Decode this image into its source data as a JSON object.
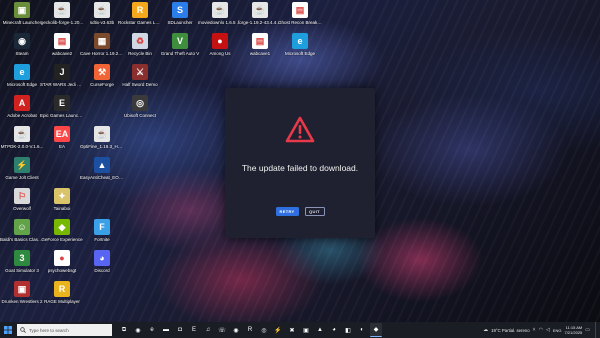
{
  "desktop": {
    "icons": [
      {
        "label": "Minecraft Launcher",
        "icon": "minecraft-icon",
        "color": "#6b8e3a",
        "glyph": "▣"
      },
      {
        "label": "geckolib-forge-1.20...",
        "icon": "java-file-icon",
        "color": "#e6e6e6",
        "glyph": "☕"
      },
      {
        "label": "sdtix-v3.63b",
        "icon": "java-file-icon",
        "color": "#e6e6e6",
        "glyph": "☕"
      },
      {
        "label": "Rockstar Games Launcher",
        "icon": "rockstar-icon",
        "color": "#f5a81c",
        "glyph": "R"
      },
      {
        "label": "SDLauncher",
        "icon": "sdlauncher-icon",
        "color": "#2b7de9",
        "glyph": "S"
      },
      {
        "label": "moviedownlo 1.6.5 (1)",
        "icon": "java-file-icon",
        "color": "#e6e6e6",
        "glyph": "☕"
      },
      {
        "label": "forge-1.19.2-43.4.4... (1)",
        "icon": "java-file-icon",
        "color": "#e6e6e6",
        "glyph": "☕"
      },
      {
        "label": "Ghost Recon Breakpoint Demo",
        "icon": "document-icon",
        "color": "#ffffff",
        "glyph": "▤"
      },
      {
        "label": "Steam",
        "icon": "steam-icon",
        "color": "#1b2838",
        "glyph": "◉"
      },
      {
        "label": "wabcave2",
        "icon": "document-icon",
        "color": "#ffffff",
        "glyph": "▤"
      },
      {
        "label": "Cave Horror 1.19.2-v1.2.7",
        "icon": "cave-horror-icon",
        "color": "#7a4a2a",
        "glyph": "▦"
      },
      {
        "label": "Recycle Bin",
        "icon": "recycle-bin-icon",
        "color": "#cfd8e3",
        "glyph": "♻"
      },
      {
        "label": "Grand Theft Auto V",
        "icon": "gta-icon",
        "color": "#3e8e3e",
        "glyph": "V"
      },
      {
        "label": "Among Us",
        "icon": "among-us-icon",
        "color": "#c51111",
        "glyph": "●"
      },
      {
        "label": "wabcave1",
        "icon": "document-icon",
        "color": "#ffffff",
        "glyph": "▤"
      },
      {
        "label": "Microsoft Edge",
        "icon": "edge-icon",
        "color": "#1f9ede",
        "glyph": "e"
      },
      {
        "label": "Microsoft Edge",
        "icon": "edge-icon",
        "color": "#1f9ede",
        "glyph": "e"
      },
      {
        "label": "STAR WARS Jedi Survivor",
        "icon": "jedi-icon",
        "color": "#222222",
        "glyph": "J"
      },
      {
        "label": "CurseForge",
        "icon": "curseforge-icon",
        "color": "#f16436",
        "glyph": "⚒"
      },
      {
        "label": "Half Sword Demo",
        "icon": "half-sword-icon",
        "color": "#8b2e2e",
        "glyph": "⚔"
      },
      {
        "label": "Adobe Acrobat",
        "icon": "acrobat-icon",
        "color": "#d2221f",
        "glyph": "A"
      },
      {
        "label": "Epic Games Launcher",
        "icon": "epic-games-icon",
        "color": "#2a2a2a",
        "glyph": "E"
      },
      {
        "label": "Ubisoft Connect",
        "icon": "ubisoft-icon",
        "color": "#3a3a3a",
        "glyph": "◎"
      },
      {
        "label": "MTPDK-2.0.0-V.1.6...",
        "icon": "java-file-icon",
        "color": "#e6e6e6",
        "glyph": "☕"
      },
      {
        "label": "EA",
        "icon": "ea-icon",
        "color": "#ff4747",
        "glyph": "EA"
      },
      {
        "label": "OptiFine_1.19.3_HD_...",
        "icon": "java-file-icon",
        "color": "#e6e6e6",
        "glyph": "☕"
      },
      {
        "label": "Game Jolt Client",
        "icon": "game-jolt-icon",
        "color": "#2f7f6f",
        "glyph": "⚡"
      },
      {
        "label": "EasyAntiCheat_EOS... - Shortcut",
        "icon": "easy-anti-cheat-icon",
        "color": "#1d4fa0",
        "glyph": "▲"
      },
      {
        "label": "Overwolf",
        "icon": "overwolf-icon",
        "color": "#d9d9d9",
        "glyph": "⚐"
      },
      {
        "label": "Tainaboi",
        "icon": "tainaboi-icon",
        "color": "#d9c46a",
        "glyph": "✦"
      },
      {
        "label": "Baldi's Basics Classic Remastered",
        "icon": "baldi-icon",
        "color": "#62a34a",
        "glyph": "☺"
      },
      {
        "label": "GeForce Experience",
        "icon": "geforce-icon",
        "color": "#76b900",
        "glyph": "◆"
      },
      {
        "label": "Fortnite",
        "icon": "fortnite-icon",
        "color": "#3aa0e8",
        "glyph": "F"
      },
      {
        "label": "Goat Simulator 3",
        "icon": "goat-sim-icon",
        "color": "#2d8a3f",
        "glyph": "3"
      },
      {
        "label": "psychowebsgt",
        "icon": "app-icon",
        "color": "#ffffff",
        "glyph": "●"
      },
      {
        "label": "Discord",
        "icon": "discord-icon",
        "color": "#5865f2",
        "glyph": "◕"
      },
      {
        "label": "Drunken Wrestlers 2",
        "icon": "drunken-wrestlers-icon",
        "color": "#b03030",
        "glyph": "▣"
      },
      {
        "label": "RAGE Multiplayer",
        "icon": "rage-mp-icon",
        "color": "#e8b31c",
        "glyph": "R"
      }
    ]
  },
  "dialog": {
    "icon": "warning-triangle-icon",
    "accent": "#e8394a",
    "message": "The update failed to download.",
    "retry_label": "RETRY",
    "quit_label": "QUIT"
  },
  "taskbar": {
    "search_placeholder": "Type here to search",
    "apps": [
      {
        "icon": "task-view-icon",
        "glyph": "⧉"
      },
      {
        "icon": "chrome-icon",
        "glyph": "◉"
      },
      {
        "icon": "edge-icon",
        "glyph": "e"
      },
      {
        "icon": "file-explorer-icon",
        "glyph": "▬"
      },
      {
        "icon": "store-icon",
        "glyph": "◘"
      },
      {
        "icon": "epic-games-icon",
        "glyph": "E"
      },
      {
        "icon": "spotify-icon",
        "glyph": "♫"
      },
      {
        "icon": "whatsapp-icon",
        "glyph": "☏"
      },
      {
        "icon": "steam-icon",
        "glyph": "◉"
      },
      {
        "icon": "rockstar-icon",
        "glyph": "R"
      },
      {
        "icon": "ubisoft-icon",
        "glyph": "◎"
      },
      {
        "icon": "game-jolt-icon",
        "glyph": "⚡"
      },
      {
        "icon": "xbox-icon",
        "glyph": "✖"
      },
      {
        "icon": "minecraft-icon",
        "glyph": "▣"
      },
      {
        "icon": "photos-icon",
        "glyph": "▲"
      },
      {
        "icon": "discord-icon",
        "glyph": "◕"
      },
      {
        "icon": "office-icon",
        "glyph": "◧"
      },
      {
        "icon": "screen-capture-icon",
        "glyph": "◐"
      },
      {
        "icon": "game-app-icon",
        "glyph": "◆"
      }
    ],
    "weather": "19°C  Partial. sereno",
    "language": "ENG",
    "time": "11:15 AM",
    "date": "7/21/2025"
  }
}
